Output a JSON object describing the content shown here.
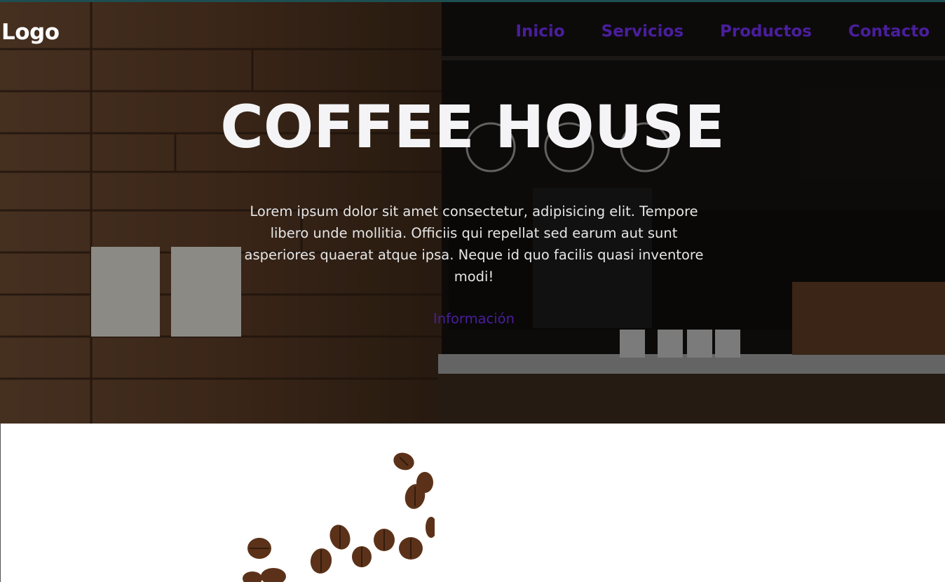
{
  "header": {
    "logo": "Logo",
    "nav": [
      "Inicio",
      "Servicios",
      "Productos",
      "Contacto"
    ]
  },
  "hero": {
    "title": "COFFEE HOUSE",
    "description": "Lorem ipsum dolor sit amet consectetur, adipisicing elit. Tempore libero unde mollitia. Officiis qui repellat sed earum aut sunt asperiores quaerat atque ipsa. Neque id quo facilis quasi inventore modi!",
    "button_label": "Información",
    "background_image": "coffee-shop-interior"
  },
  "section": {
    "image": "coffee-beans"
  },
  "colors": {
    "accent": "#4a1e9e",
    "title": "#f4f4f6",
    "top_strip": "#1d4f52"
  }
}
